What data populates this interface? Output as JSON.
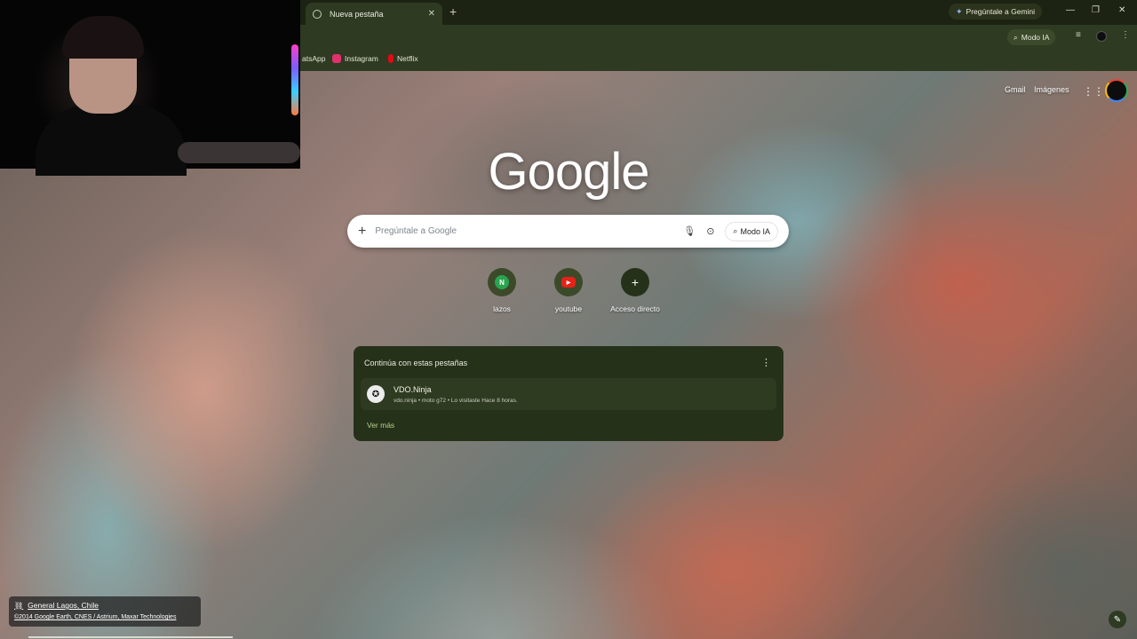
{
  "browser": {
    "tab": {
      "title": "Nueva pestaña",
      "favicon": "chrome-icon",
      "close": "✕"
    },
    "new_tab_symbol": "+",
    "gemini_label": "Pregúntale a Gemini",
    "window_controls": {
      "minimize": "—",
      "restore": "❐",
      "close": "✕"
    },
    "toolbar": {
      "modo_ia_label": "Modo IA"
    },
    "bookmarks": [
      {
        "label": "atsApp",
        "color": "#25d366"
      },
      {
        "label": "Instagram",
        "color": "#e1306c"
      },
      {
        "label": "Netflix",
        "color": "#e50914"
      }
    ]
  },
  "ntp": {
    "top_links": {
      "gmail": "Gmail",
      "images": "Imágenes"
    },
    "logo": "Google",
    "search": {
      "placeholder": "Pregúntale a Google",
      "modo_ia_label": "Modo IA"
    },
    "shortcuts": [
      {
        "label": "lazos",
        "letter": "N",
        "color": "#2aa44f"
      },
      {
        "label": "youtube",
        "letter": "▶",
        "color": "#e62117"
      },
      {
        "label": "Acceso directo",
        "letter": "+",
        "color": "#3c4a2a"
      }
    ],
    "tabs_card": {
      "title": "Continúa con estas pestañas",
      "item": {
        "title": "VDO.Ninja",
        "subtitle": "vdo.ninja • moto g72 • Lo visitaste Hace 8 horas."
      },
      "see_more": "Ver más"
    },
    "attribution": {
      "location": "General Lagos, Chile",
      "copyright": "©2014 Google Earth, CNES / Astrium, Maxar Technologies"
    }
  },
  "colors": {
    "frame": "#2f3a22",
    "tabstrip": "#1d2313",
    "accent": "#b9d28f"
  }
}
